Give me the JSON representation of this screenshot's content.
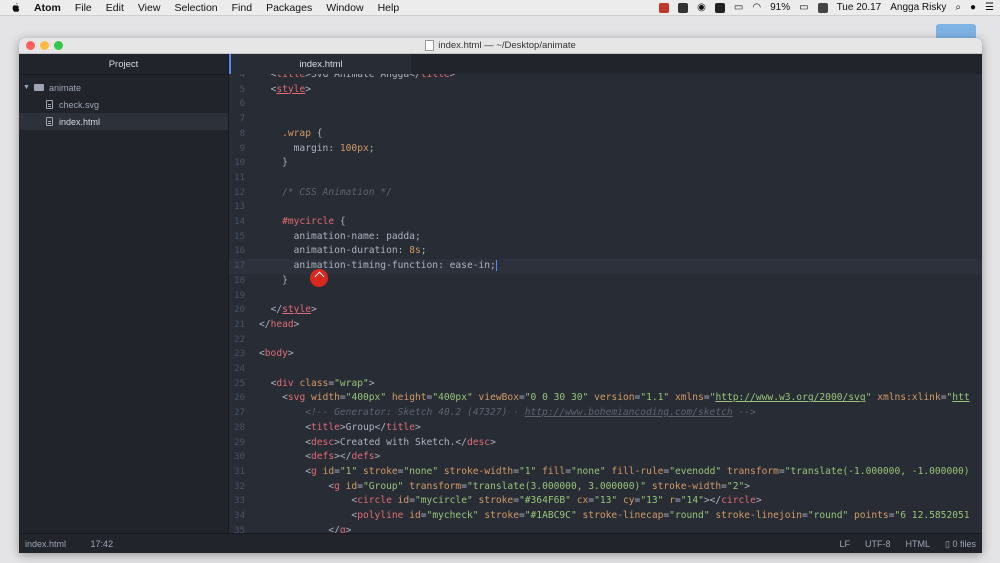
{
  "menubar": {
    "app": "Atom",
    "items": [
      "File",
      "Edit",
      "View",
      "Selection",
      "Find",
      "Packages",
      "Window",
      "Help"
    ],
    "battery": "91%",
    "clock": "Tue 20.17",
    "user": "Angga Risky"
  },
  "window": {
    "title": "index.html — ~/Desktop/animate"
  },
  "sidebar": {
    "header": "Project",
    "root": "animate",
    "files": [
      "check.svg",
      "index.html"
    ]
  },
  "tabs": {
    "active": "index.html"
  },
  "editor": {
    "lines": [
      {
        "n": "4",
        "html": "  <span class='p'>&lt;</span><span class='t'>title</span><span class='p'>&gt;SVG Animate Angga&lt;/</span><span class='t'>title</span><span class='p'>&gt;</span>"
      },
      {
        "n": "5",
        "html": "  <span class='p'>&lt;</span><span class='t u'>style</span><span class='p'>&gt;</span>"
      },
      {
        "n": "6",
        "html": ""
      },
      {
        "n": "7",
        "html": ""
      },
      {
        "n": "8",
        "html": "    <span class='a'>.wrap</span> <span class='p'>{</span>"
      },
      {
        "n": "9",
        "html": "      <span class='prop'>margin</span>: <span class='num'>100px</span>;"
      },
      {
        "n": "10",
        "html": "    <span class='p'>}</span>"
      },
      {
        "n": "11",
        "html": ""
      },
      {
        "n": "12",
        "html": "    <span class='c'>/* CSS Animation */</span>"
      },
      {
        "n": "13",
        "html": ""
      },
      {
        "n": "14",
        "html": "    <span class='sel'>#mycircle</span> <span class='p'>{</span>"
      },
      {
        "n": "15",
        "html": "      <span class='prop'>animation-name</span>: padda;"
      },
      {
        "n": "16",
        "html": "      <span class='prop'>animation-duration</span>: <span class='num'>8s</span>;"
      },
      {
        "n": "17",
        "html": "      <span class='prop'>animation-timing-function</span>: ease-in;<span class='caret-bar'></span>"
      },
      {
        "n": "18",
        "html": "    <span class='p'>}</span>"
      },
      {
        "n": "19",
        "html": ""
      },
      {
        "n": "20",
        "html": "  <span class='p'>&lt;/</span><span class='t u'>style</span><span class='p'>&gt;</span>"
      },
      {
        "n": "21",
        "html": "<span class='p'>&lt;/</span><span class='t'>head</span><span class='p'>&gt;</span>"
      },
      {
        "n": "22",
        "html": ""
      },
      {
        "n": "23",
        "html": "<span class='p'>&lt;</span><span class='t'>body</span><span class='p'>&gt;</span>"
      },
      {
        "n": "24",
        "html": ""
      },
      {
        "n": "25",
        "html": "  <span class='p'>&lt;</span><span class='t'>div</span> <span class='a'>class</span>=<span class='s'>\"wrap\"</span><span class='p'>&gt;</span>"
      },
      {
        "n": "26",
        "html": "    <span class='p'>&lt;</span><span class='t'>svg</span> <span class='a'>width</span>=<span class='s'>\"400px\"</span> <span class='a'>height</span>=<span class='s'>\"400px\"</span> <span class='a'>viewBox</span>=<span class='s'>\"0 0 30 30\"</span> <span class='a'>version</span>=<span class='s'>\"1.1\"</span> <span class='a'>xmlns</span>=<span class='s'>\"<span class='u'>http://www.w3.org/2000/svg</span>\"</span> <span class='a'>xmlns:xlink</span>=<span class='s'>\"<span class='u'>htt</span></span>"
      },
      {
        "n": "27",
        "html": "        <span class='c'>&lt;!-- Generator: Sketch 40.2 (47327) - <span class='u'>http://www.bohemiancoding.com/sketch</span> --&gt;</span>"
      },
      {
        "n": "28",
        "html": "        <span class='p'>&lt;</span><span class='t'>title</span><span class='p'>&gt;Group&lt;/</span><span class='t'>title</span><span class='p'>&gt;</span>"
      },
      {
        "n": "29",
        "html": "        <span class='p'>&lt;</span><span class='t'>desc</span><span class='p'>&gt;Created with Sketch.&lt;/</span><span class='t'>desc</span><span class='p'>&gt;</span>"
      },
      {
        "n": "30",
        "html": "        <span class='p'>&lt;</span><span class='t'>defs</span><span class='p'>&gt;&lt;/</span><span class='t'>defs</span><span class='p'>&gt;</span>"
      },
      {
        "n": "31",
        "html": "        <span class='p'>&lt;</span><span class='t'>g</span> <span class='a'>id</span>=<span class='s'>\"1\"</span> <span class='a'>stroke</span>=<span class='s'>\"none\"</span> <span class='a'>stroke-width</span>=<span class='s'>\"1\"</span> <span class='a'>fill</span>=<span class='s'>\"none\"</span> <span class='a'>fill-rule</span>=<span class='s'>\"evenodd\"</span> <span class='a'>transform</span>=<span class='s'>\"translate(-1.000000, -1.000000)</span>"
      },
      {
        "n": "32",
        "html": "            <span class='p'>&lt;</span><span class='t'>g</span> <span class='a'>id</span>=<span class='s'>\"Group\"</span> <span class='a'>transform</span>=<span class='s'>\"translate(3.000000, 3.000000)\"</span> <span class='a'>stroke-width</span>=<span class='s'>\"2\"</span><span class='p'>&gt;</span>"
      },
      {
        "n": "33",
        "html": "                <span class='p'>&lt;</span><span class='t'>circle</span> <span class='a'>id</span>=<span class='s'>\"mycircle\"</span> <span class='a'>stroke</span>=<span class='s'>\"#364F6B\"</span> <span class='a'>cx</span>=<span class='s'>\"13\"</span> <span class='a'>cy</span>=<span class='s'>\"13\"</span> <span class='a'>r</span>=<span class='s'>\"14\"</span><span class='p'>&gt;&lt;/</span><span class='t'>circle</span><span class='p'>&gt;</span>"
      },
      {
        "n": "34",
        "html": "                <span class='p'>&lt;</span><span class='t'>polyline</span> <span class='a'>id</span>=<span class='s'>\"mycheck\"</span> <span class='a'>stroke</span>=<span class='s'>\"#1ABC9C\"</span> <span class='a'>stroke-linecap</span>=<span class='s'>\"round\"</span> <span class='a'>stroke-linejoin</span>=<span class='s'>\"round\"</span> <span class='a'>points</span>=<span class='s'>\"6 12.5852051</span>"
      },
      {
        "n": "35",
        "html": "            <span class='p'>&lt;/</span><span class='t'>g</span><span class='p'>&gt;</span>"
      }
    ]
  },
  "status": {
    "file": "index.html",
    "position": "17:42",
    "line_ending": "LF",
    "encoding": "UTF-8",
    "grammar": "HTML",
    "git": "0 files"
  }
}
